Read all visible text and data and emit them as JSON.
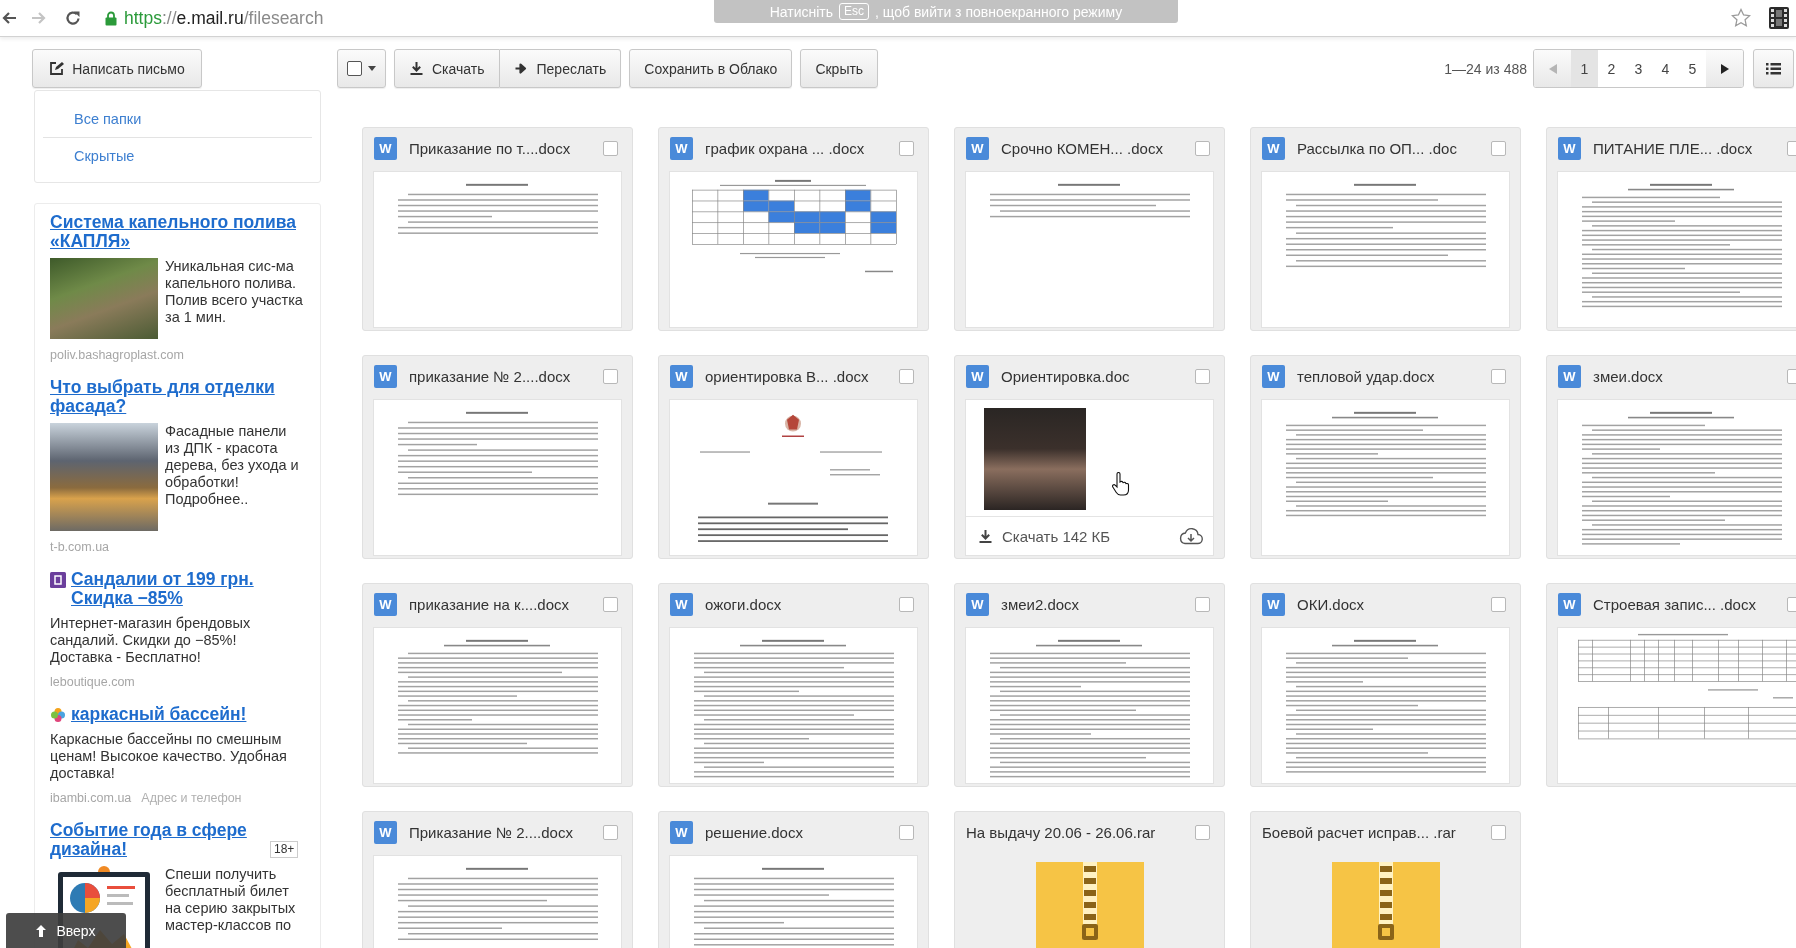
{
  "browser": {
    "back": {
      "disabled": false
    },
    "forward": {
      "disabled": true
    },
    "url": [
      {
        "text": "https",
        "kind": "secure"
      },
      {
        "text": "://",
        "kind": "dim"
      },
      {
        "text": "e.mail.ru",
        "kind": "host"
      },
      {
        "text": "/filesearch",
        "kind": "dim"
      }
    ],
    "bookmarked": false,
    "fullscreen_notice": {
      "before": "Натисніть",
      "key": "Esc",
      "after": ", щоб вийти з повноекранного режиму"
    }
  },
  "toolbar": {
    "compose": "Написать письмо",
    "select_all": {
      "checked": false
    },
    "action_groups": [
      [
        {
          "label": "Скачать",
          "kind": "download"
        },
        {
          "label": "Переслать",
          "kind": "forward"
        }
      ],
      [
        {
          "label": "Сохранить в Облако",
          "kind": "plain"
        }
      ],
      [
        {
          "label": "Скрыть",
          "kind": "plain"
        }
      ]
    ],
    "range": "1—24 из 488",
    "prev": {
      "disabled": true
    },
    "pages": [
      {
        "label": "1",
        "selected": true
      },
      {
        "label": "2",
        "selected": false
      },
      {
        "label": "3",
        "selected": false
      },
      {
        "label": "4",
        "selected": false
      },
      {
        "label": "5",
        "selected": false
      }
    ],
    "next": {
      "disabled": false
    }
  },
  "sidebar": {
    "folders": [
      {
        "label": "Все папки"
      },
      {
        "label": "Скрытые"
      }
    ]
  },
  "ads": [
    {
      "kind": "garden",
      "title": "Система капельного полива «КАПЛЯ»",
      "text": "Уникальная сис-ма капельного полива. Полив всего участка за 1 мин.",
      "domain": "poliv.bashagroplast.com"
    },
    {
      "kind": "facade",
      "title": "Что выбрать для отделки фасада?",
      "text": "Фасадные панели из ДПК - красота дерева, без ухода и обработки! Подробнее..",
      "domain": "t-b.com.ua"
    },
    {
      "kind": "shop",
      "title": "Сандалии от 199 грн. Скидка −85%",
      "text": "Интернет-магазин брендовых сандалий. Скидки до −85%! Доставка - Бесплатно!",
      "domain": "leboutique.com"
    },
    {
      "kind": "pool",
      "title": "каркасный бассейн!",
      "text": "Каркасные бассейны по смешным ценам! Высокое качество. Удобная доставка!",
      "domain": "ibambi.com.ua",
      "contact": "Адрес и телефон"
    },
    {
      "kind": "design",
      "title": "Событие года в сфере дизайна!",
      "badge": "18+",
      "text": "Спеши получить бесплатный билет на серию закрытых мастер-классов по"
    }
  ],
  "files": [
    {
      "name": "Приказание по т....docx",
      "kind": "text",
      "mark": "W",
      "checked": false
    },
    {
      "name": "график охрана ... .docx",
      "kind": "schedule",
      "mark": "W",
      "checked": false
    },
    {
      "name": "Срочно КОМЕН... .docx",
      "kind": "text",
      "mark": "W",
      "checked": false
    },
    {
      "name": "Рассылка по ОП... .doc",
      "kind": "text",
      "mark": "W",
      "checked": false
    },
    {
      "name": "ПИТАНИЕ ПЛЕ... .docx",
      "kind": "text",
      "mark": "W",
      "checked": false
    },
    {
      "name": "приказание № 2....docx",
      "kind": "text",
      "mark": "W",
      "checked": false
    },
    {
      "name": "ориентировка В... .docx",
      "kind": "emblem",
      "mark": "W",
      "checked": false
    },
    {
      "name": "Ориентировка.doc",
      "kind": "photo",
      "mark": "W",
      "checked": false,
      "hover": {
        "download": "Скачать 142 КБ"
      }
    },
    {
      "name": "тепловой удар.docx",
      "kind": "text",
      "mark": "W",
      "checked": false
    },
    {
      "name": "змеи.docx",
      "kind": "text",
      "mark": "W",
      "checked": false
    },
    {
      "name": "приказание на к....docx",
      "kind": "text",
      "mark": "W",
      "checked": false
    },
    {
      "name": "ожоги.docx",
      "kind": "text",
      "mark": "W",
      "checked": false
    },
    {
      "name": "змеи2.docx",
      "kind": "text",
      "mark": "W",
      "checked": false
    },
    {
      "name": "ОКИ.docx",
      "kind": "text",
      "mark": "W",
      "checked": false
    },
    {
      "name": "Строевая запис... .docx",
      "kind": "table",
      "mark": "W",
      "checked": false
    },
    {
      "name": "Приказание № 2....docx",
      "kind": "text",
      "mark": "W",
      "checked": false
    },
    {
      "name": "решение.docx",
      "kind": "text",
      "mark": "W",
      "checked": false
    },
    {
      "name": "На выдачу 20.06 - 26.06.rar",
      "kind": "archive",
      "checked": false
    },
    {
      "name": "Боевой расчет исправ... .rar",
      "kind": "archive",
      "checked": false
    }
  ],
  "scroll_top": {
    "label": "Вверх"
  }
}
